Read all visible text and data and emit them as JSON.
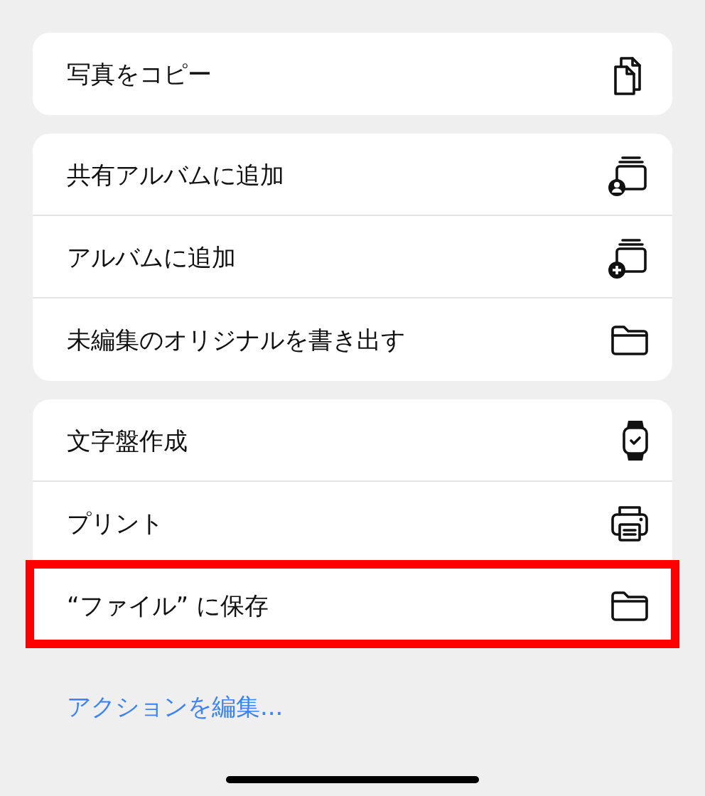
{
  "groups": [
    {
      "items": [
        {
          "label": "写真をコピー",
          "kind": "copy",
          "highlighted": false
        }
      ]
    },
    {
      "items": [
        {
          "label": "共有アルバムに追加",
          "kind": "shared-album",
          "highlighted": false
        },
        {
          "label": "アルバムに追加",
          "kind": "album",
          "highlighted": false
        },
        {
          "label": "未編集のオリジナルを書き出す",
          "kind": "folder",
          "highlighted": false
        }
      ]
    },
    {
      "items": [
        {
          "label": "文字盤作成",
          "kind": "watch",
          "highlighted": false
        },
        {
          "label": "プリント",
          "kind": "printer",
          "highlighted": false
        },
        {
          "label": "“ファイル” に保存",
          "kind": "folder",
          "highlighted": true
        }
      ]
    }
  ],
  "edit_actions": "アクションを編集..."
}
